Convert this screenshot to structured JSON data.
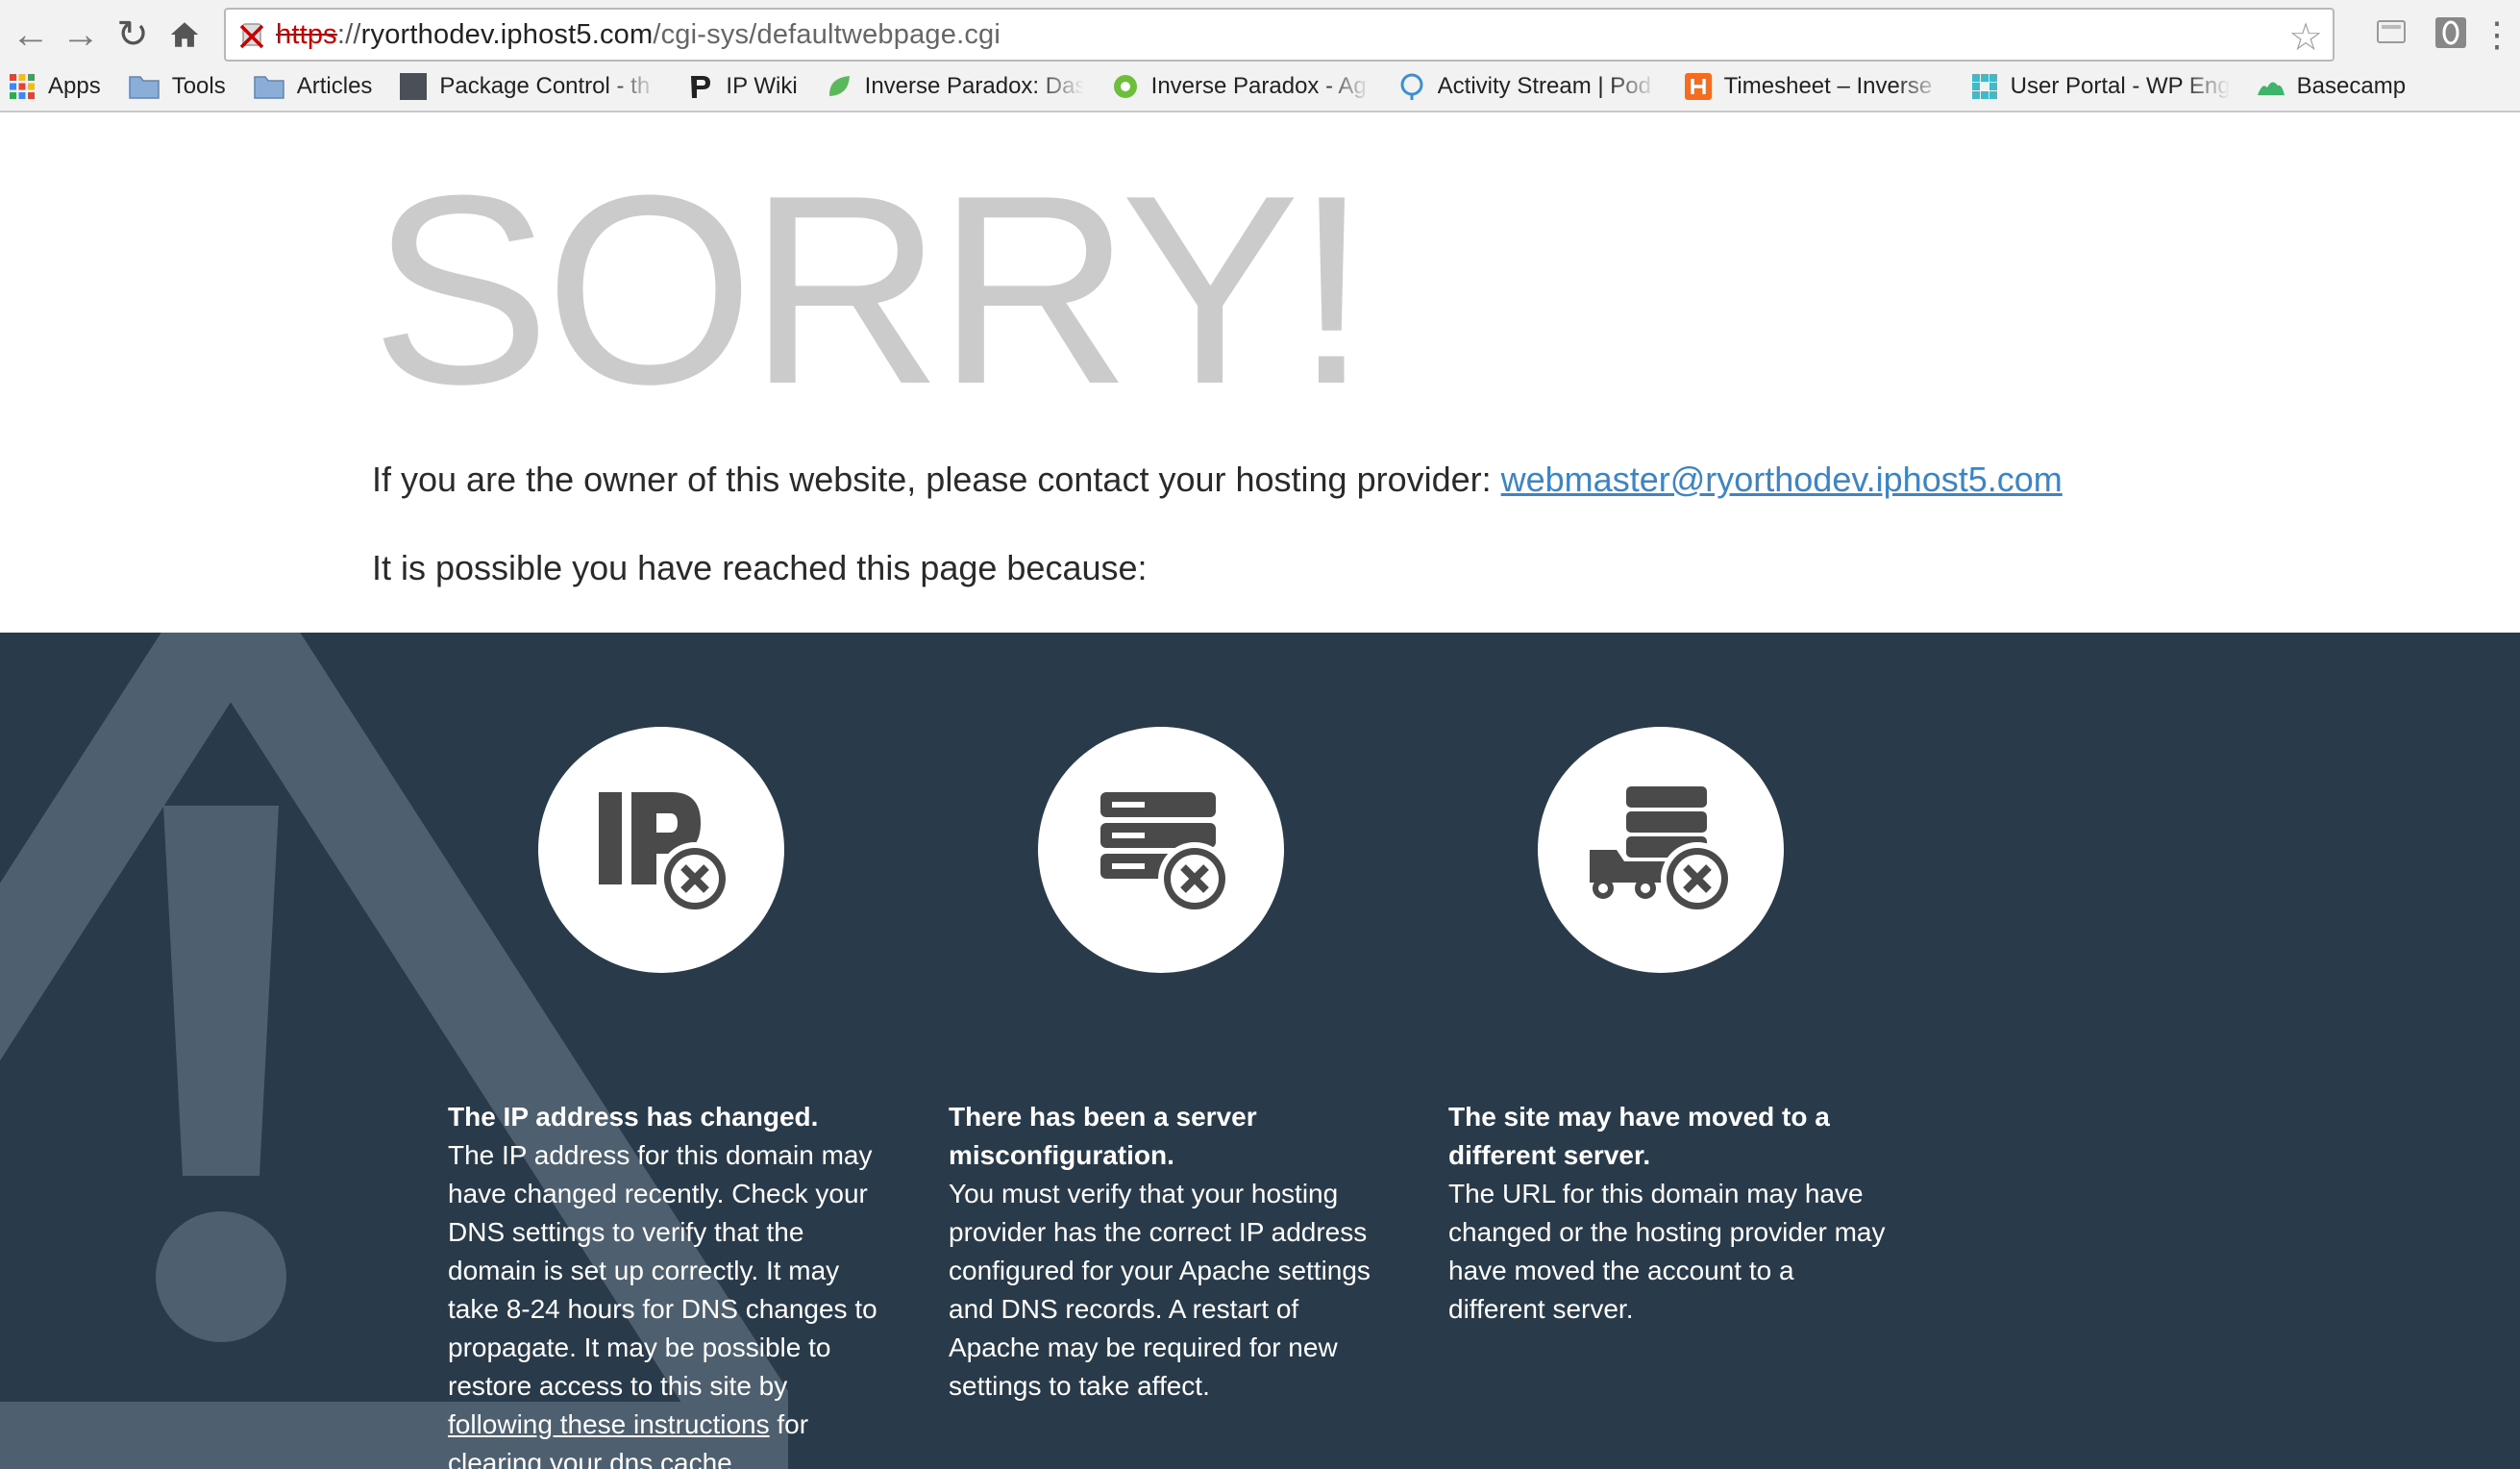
{
  "browser": {
    "url_protocol": "https",
    "url_sep": "://",
    "url_host": "ryorthodev.iphost5.com",
    "url_path": "/cgi-sys/defaultwebpage.cgi",
    "bookmarks": [
      {
        "label": "Apps",
        "icon": "apps-grid-icon"
      },
      {
        "label": "Tools",
        "icon": "folder-icon"
      },
      {
        "label": "Articles",
        "icon": "folder-icon"
      },
      {
        "label": "Package Control - th",
        "icon": "package-control-icon"
      },
      {
        "label": "IP Wiki",
        "icon": "ip-wiki-icon"
      },
      {
        "label": "Inverse Paradox: Das",
        "icon": "leaf-icon"
      },
      {
        "label": "Inverse Paradox - Ag",
        "icon": "gear-green-icon"
      },
      {
        "label": "Activity Stream | Pod",
        "icon": "podio-icon"
      },
      {
        "label": "Timesheet – Inverse",
        "icon": "harvest-icon"
      },
      {
        "label": "User Portal - WP Eng",
        "icon": "wpengine-icon"
      },
      {
        "label": "Basecamp",
        "icon": "basecamp-icon"
      }
    ]
  },
  "page": {
    "headline": "SORRY!",
    "owner_text": "If you are the owner of this website, please contact your hosting provider: ",
    "owner_email": "webmaster@ryorthodev.iphost5.com",
    "reached_text": "It is possible you have reached this page because:",
    "reasons": [
      {
        "icon": "ip-error-icon",
        "title": "The IP address has changed.",
        "body": "The IP address for this domain may have changed recently. Check your DNS settings to verify that the domain is set up correctly. It may take 8-24 hours for DNS changes to propagate. It may be possible to restore access to this site by ",
        "link": "following these instructions",
        "body_after": " for clearing your dns cache."
      },
      {
        "icon": "server-error-icon",
        "title": "There has been a server misconfiguration.",
        "body": "You must verify that your hosting provider has the correct IP address configured for your Apache settings and DNS records. A restart of Apache may be required for new settings to take affect."
      },
      {
        "icon": "server-moved-error-icon",
        "title": "The site may have moved to a different server.",
        "body": "The URL for this domain may have changed or the hosting provider may have moved the account to a different server."
      }
    ]
  },
  "colors": {
    "dark_panel": "#293a4b",
    "link": "#3c84c5",
    "headline": "#cbcbcb",
    "icon": "#4a4a4a"
  }
}
